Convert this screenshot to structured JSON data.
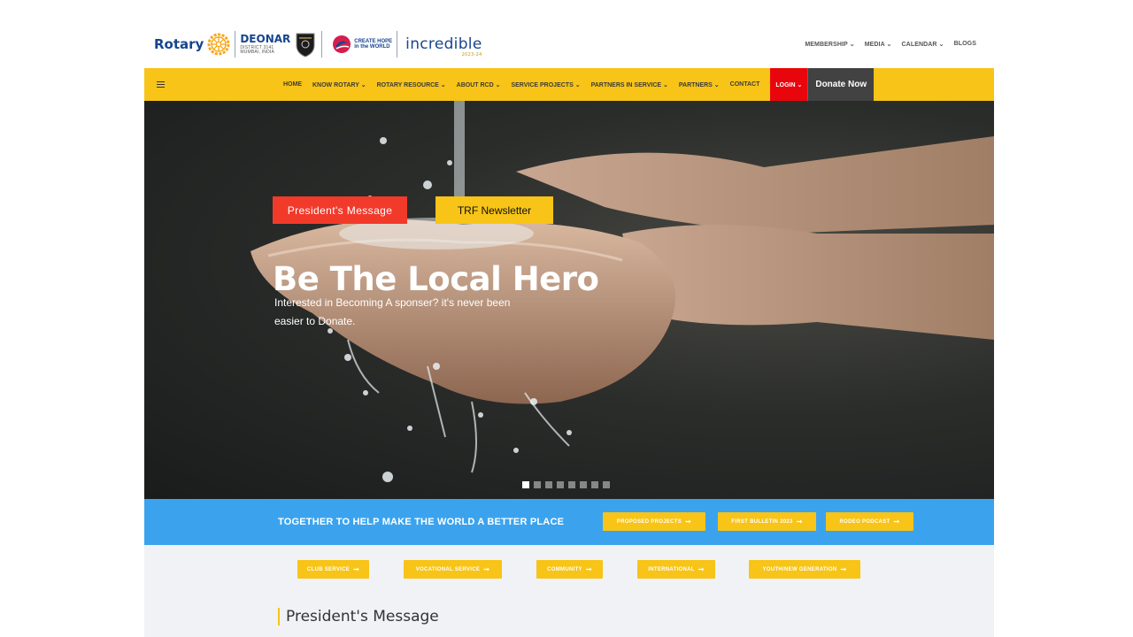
{
  "brand": {
    "rotary_text": "Rotary",
    "district_title": "DEONAR",
    "district_sub1": "DISTRICT 3141",
    "district_sub2": "MUMBAI, INDIA",
    "hope_line1": "CREATE HOPE",
    "hope_line2": "in the WORLD",
    "incredible_text": "incredible",
    "incredible_year": "2023-24",
    "colors": {
      "rotary_blue": "#17458f",
      "rotary_gold": "#f7c417"
    }
  },
  "top_nav": [
    {
      "label": "MEMBERSHIP",
      "caret": "⌄"
    },
    {
      "label": "MEDIA",
      "caret": "⌄"
    },
    {
      "label": "CALENDAR",
      "caret": "⌄"
    },
    {
      "label": "BLOGS",
      "caret": ""
    }
  ],
  "main_nav": {
    "items": [
      {
        "label": "HOME"
      },
      {
        "label": "KNOW ROTARY ⌄"
      },
      {
        "label": "ROTARY RESOURCE ⌄"
      },
      {
        "label": "ABOUT RCD ⌄"
      },
      {
        "label": "SERVICE PROJECTS ⌄"
      },
      {
        "label": "PARTNERS IN SERVICE ⌄"
      },
      {
        "label": "PARTNERS ⌄"
      },
      {
        "label": "CONTACT"
      }
    ],
    "login_label": "LOGIN ⌄",
    "donate_label": "Donate Now",
    "colors": {
      "bar": "#f7c417",
      "login": "#e8060c",
      "donate": "#424242"
    }
  },
  "hero": {
    "btn_president": "President's Message",
    "btn_newsletter": "TRF Newsletter",
    "title": "Be The Local Hero",
    "subtitle": "Interested in Becoming A sponser? it's never been easier to Donate.",
    "slide_count": 8,
    "active_slide": 1
  },
  "band": {
    "text": "TOGETHER TO HELP MAKE THE WORLD A BETTER PLACE",
    "buttons": [
      {
        "label": "PROPOSED PROJECTS"
      },
      {
        "label": "FIRST BULLETIN 2023"
      },
      {
        "label": "RODEO PODCAST"
      }
    ],
    "color": "#3ba3ee"
  },
  "services": {
    "buttons": [
      {
        "label": "CLUB SERVICE"
      },
      {
        "label": "VOCATIONAL SERVICE"
      },
      {
        "label": "COMMUNITY"
      },
      {
        "label": "INTERNATIONAL"
      },
      {
        "label": "YOUTH/NEW GENERATION"
      }
    ],
    "section_title": "President's Message"
  },
  "icons": {
    "menu": "hamburger-icon",
    "arrow": "arrow-right-icon",
    "wheel": "rotary-wheel-icon"
  }
}
